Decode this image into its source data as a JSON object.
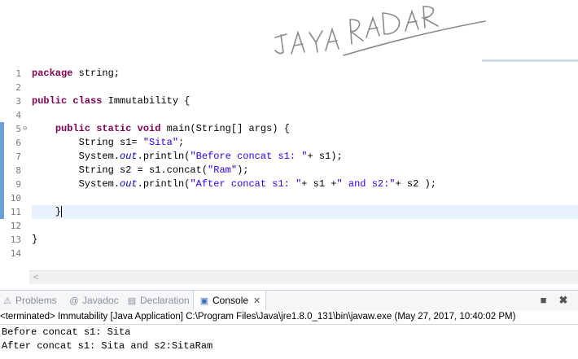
{
  "watermark": {
    "text": "JAYA RADAR"
  },
  "editor": {
    "line_numbers": [
      "1",
      "2",
      "3",
      "4",
      "5",
      "6",
      "7",
      "8",
      "9",
      "10",
      "11",
      "12",
      "13",
      "14"
    ],
    "lines": [
      [
        {
          "t": "package",
          "c": "kw"
        },
        {
          "t": " string;",
          "c": ""
        }
      ],
      [],
      [
        {
          "t": "public",
          "c": "kw"
        },
        {
          "t": " ",
          "c": ""
        },
        {
          "t": "class",
          "c": "kw"
        },
        {
          "t": " Immutability {",
          "c": ""
        }
      ],
      [],
      [
        {
          "t": "    ",
          "c": ""
        },
        {
          "t": "public",
          "c": "kw"
        },
        {
          "t": " ",
          "c": ""
        },
        {
          "t": "static",
          "c": "kw"
        },
        {
          "t": " ",
          "c": ""
        },
        {
          "t": "void",
          "c": "kw"
        },
        {
          "t": " main(String[] args) {",
          "c": ""
        }
      ],
      [
        {
          "t": "        String s1= ",
          "c": ""
        },
        {
          "t": "\"Sita\"",
          "c": "str"
        },
        {
          "t": ";",
          "c": ""
        }
      ],
      [
        {
          "t": "        System.",
          "c": ""
        },
        {
          "t": "out",
          "c": "fld"
        },
        {
          "t": ".println(",
          "c": ""
        },
        {
          "t": "\"Before concat s1: \"",
          "c": "str"
        },
        {
          "t": "+ s1);",
          "c": ""
        }
      ],
      [
        {
          "t": "        String s2 = s1.concat(",
          "c": ""
        },
        {
          "t": "\"Ram\"",
          "c": "str"
        },
        {
          "t": ");",
          "c": ""
        }
      ],
      [
        {
          "t": "        System.",
          "c": ""
        },
        {
          "t": "out",
          "c": "fld"
        },
        {
          "t": ".println(",
          "c": ""
        },
        {
          "t": "\"After concat s1: \"",
          "c": "str"
        },
        {
          "t": "+ s1 +",
          "c": ""
        },
        {
          "t": "\" and s2:\"",
          "c": "str"
        },
        {
          "t": "+ s2 );",
          "c": ""
        }
      ],
      [],
      [
        {
          "t": "    }",
          "c": ""
        }
      ],
      [],
      [
        {
          "t": "}",
          "c": ""
        }
      ],
      []
    ],
    "changed_lines": [
      5,
      6,
      7,
      8,
      9,
      10,
      11
    ],
    "current_line": 11,
    "fold_marker": "⊖"
  },
  "panel": {
    "tabs": [
      {
        "label": "Problems",
        "icon": "⚠",
        "icon_name": "problems-icon"
      },
      {
        "label": "Javadoc",
        "icon": "@",
        "icon_name": "javadoc-icon"
      },
      {
        "label": "Declaration",
        "icon": "▤",
        "icon_name": "declaration-icon"
      },
      {
        "label": "Console",
        "icon": "▣",
        "icon_name": "console-icon"
      }
    ],
    "active_tab": "Console",
    "close_glyph": "✕",
    "status": "<terminated> Immutability [Java Application] C:\\Program Files\\Java\\jre1.8.0_131\\bin\\javaw.exe (May 27, 2017, 10:40:02 PM)",
    "output": [
      "Before concat s1: Sita",
      "After concat s1: Sita and s2:SitaRam"
    ]
  }
}
